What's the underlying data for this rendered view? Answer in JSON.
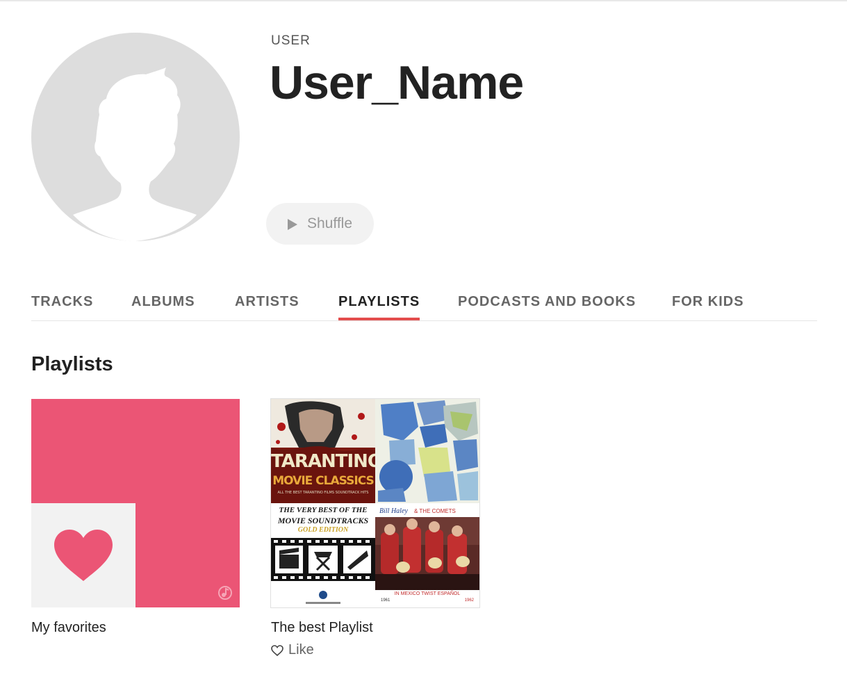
{
  "profile": {
    "kind_label": "USER",
    "name": "User_Name",
    "avatar_icon": "user-silhouette-icon",
    "shuffle_label": "Shuffle"
  },
  "tabs": [
    {
      "label": "TRACKS",
      "active": false
    },
    {
      "label": "ALBUMS",
      "active": false
    },
    {
      "label": "ARTISTS",
      "active": false
    },
    {
      "label": "PLAYLISTS",
      "active": true
    },
    {
      "label": "PODCASTS AND BOOKS",
      "active": false
    },
    {
      "label": "FOR KIDS",
      "active": false
    }
  ],
  "section": {
    "title": "Playlists"
  },
  "playlists": [
    {
      "title": "My favorites",
      "icon": "heart-icon",
      "colors": {
        "cover": "#eb5575",
        "inner": "#f2f2f2"
      }
    },
    {
      "title": "The best Playlist",
      "like_label": "Like",
      "covers": {
        "tarantino": {
          "line1": "TARANTINO",
          "line2": "MOVIE CLASSICS",
          "line3": "ALL THE BEST TARANTINO FILMS SOUNDTRACK HITS"
        },
        "soundtracks": {
          "line1": "THE VERY BEST OF THE",
          "line2": "MOVIE SOUNDTRACKS",
          "line3": "GOLD EDITION"
        },
        "haley": {
          "artist": "Bill Haley",
          "band": "& THE COMETS",
          "subtitle": "IN MEXICO TWIST ESPAÑOL",
          "year_start": "1961",
          "year_end": "1962"
        }
      }
    }
  ],
  "colors": {
    "accent": "#e34d4d",
    "text": "#222222",
    "muted": "#666666"
  }
}
